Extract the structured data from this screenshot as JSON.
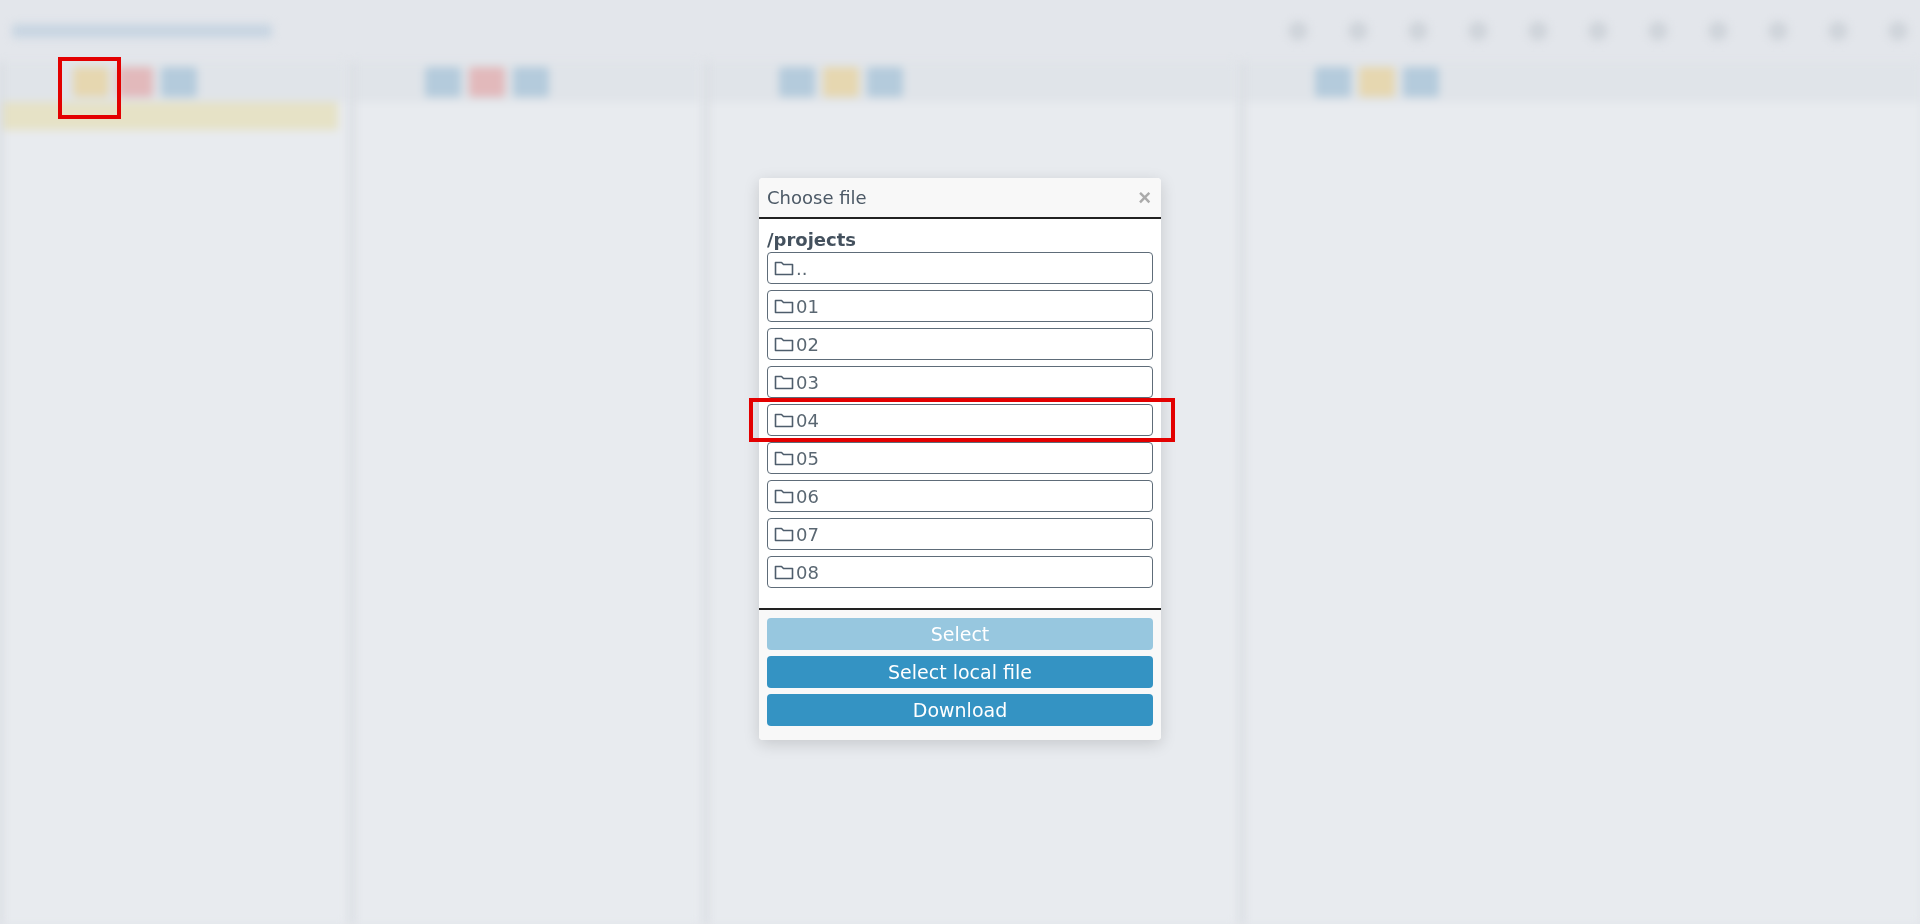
{
  "dialog": {
    "title": "Choose file",
    "close": "×",
    "path": "/projects",
    "entries": [
      {
        "name": "..",
        "highlighted": false
      },
      {
        "name": "01",
        "highlighted": false
      },
      {
        "name": "02",
        "highlighted": false
      },
      {
        "name": "03",
        "highlighted": false
      },
      {
        "name": "04",
        "highlighted": true
      },
      {
        "name": "05",
        "highlighted": false
      },
      {
        "name": "06",
        "highlighted": false
      },
      {
        "name": "07",
        "highlighted": false
      },
      {
        "name": "08",
        "highlighted": false
      }
    ],
    "buttons": [
      {
        "label": "Select",
        "disabled": true
      },
      {
        "label": "Select local file",
        "disabled": false
      },
      {
        "label": "Download",
        "disabled": false
      }
    ]
  },
  "annotations": {
    "open_button_highlighted": true
  }
}
